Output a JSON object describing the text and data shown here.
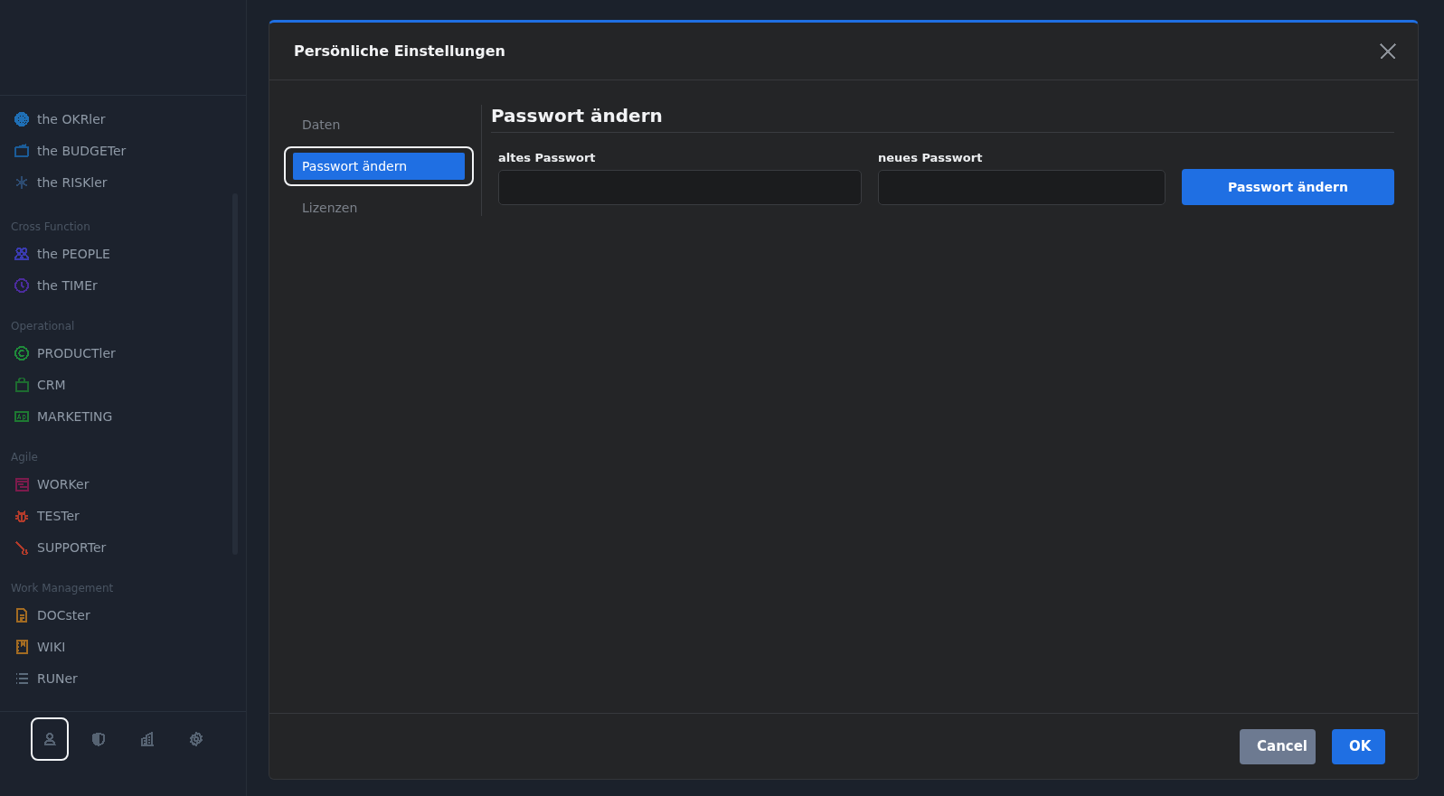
{
  "sidebar": {
    "sections": [
      {
        "items": [
          {
            "label": "the OKRler",
            "color": "#1f6fb5"
          },
          {
            "label": "the BUDGETer",
            "color": "#1b5c98"
          },
          {
            "label": "the RISKler",
            "color": "#2d4b70"
          }
        ]
      },
      {
        "title": "Cross Function",
        "items": [
          {
            "label": "the PEOPLE",
            "color": "#3a3bb0"
          },
          {
            "label": "the TIMEr",
            "color": "#4b2c9c"
          }
        ]
      },
      {
        "title": "Operational",
        "items": [
          {
            "label": "PRODUCTler",
            "color": "#1f8a3a"
          },
          {
            "label": "CRM",
            "color": "#1d6b30"
          },
          {
            "label": "MARKETING",
            "color": "#1e7a32"
          }
        ]
      },
      {
        "title": "Agile",
        "items": [
          {
            "label": "WORKer",
            "color": "#7c1b4c"
          },
          {
            "label": "TESTer",
            "color": "#b23b2b"
          },
          {
            "label": "SUPPORTer",
            "color": "#b23b2b"
          }
        ]
      },
      {
        "title": "Work Management",
        "items": [
          {
            "label": "DOCster",
            "color": "#a26b22"
          },
          {
            "label": "WIKI",
            "color": "#a26b22"
          },
          {
            "label": "RUNer",
            "color": "#5b6b7b"
          }
        ]
      }
    ],
    "bottom_icons": [
      {
        "selected": true
      },
      {
        "selected": false
      },
      {
        "selected": false
      },
      {
        "selected": false
      }
    ]
  },
  "dialog": {
    "title": "Persönliche Einstellungen",
    "tabs": [
      {
        "label": "Daten",
        "selected": false
      },
      {
        "label": "Passwort ändern",
        "selected": true
      },
      {
        "label": "Lizenzen",
        "selected": false
      }
    ],
    "heading": "Passwort ändern",
    "fields": [
      {
        "label": "altes Passwort"
      },
      {
        "label": "neues Passwort"
      }
    ],
    "submit": "Passwort ändern",
    "buttons": [
      {
        "label": "Cancel",
        "kind": "secondary"
      },
      {
        "label": "OK",
        "kind": "primary"
      }
    ]
  }
}
